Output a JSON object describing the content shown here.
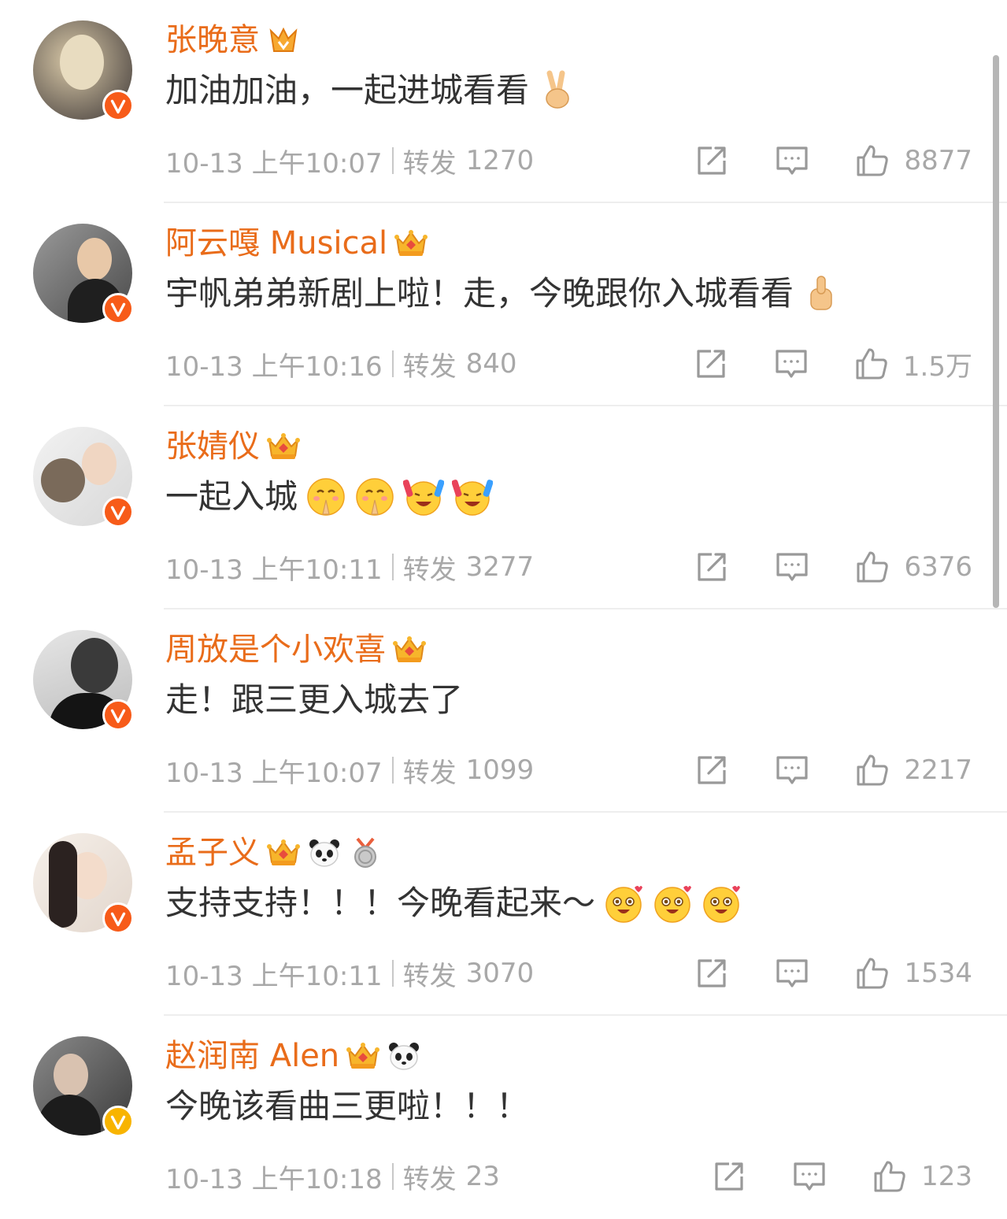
{
  "comments": [
    {
      "username": "张晚意",
      "text": "加油加油，一起进城看看",
      "time": "10-13 上午10:07",
      "repost_label": "转发",
      "repost_count": "1270",
      "likes": "8877",
      "verified_color": "#f75b19"
    },
    {
      "username": "阿云嘎 Musical",
      "text": "宇帆弟弟新剧上啦！走，今晚跟你入城看看",
      "time": "10-13 上午10:16",
      "repost_label": "转发",
      "repost_count": "840",
      "likes": "1.5万",
      "verified_color": "#f75b19"
    },
    {
      "username": "张婧仪",
      "text": "一起入城",
      "time": "10-13 上午10:11",
      "repost_label": "转发",
      "repost_count": "3277",
      "likes": "6376",
      "verified_color": "#f75b19"
    },
    {
      "username": "周放是个小欢喜",
      "text": "走！跟三更入城去了",
      "time": "10-13 上午10:07",
      "repost_label": "转发",
      "repost_count": "1099",
      "likes": "2217",
      "verified_color": "#f75b19"
    },
    {
      "username": "孟子义",
      "text": "支持支持！！！今晚看起来～",
      "time": "10-13 上午10:11",
      "repost_label": "转发",
      "repost_count": "3070",
      "likes": "1534",
      "verified_color": "#f75b19"
    },
    {
      "username": "赵润南 Alen",
      "text": "今晚该看曲三更啦！！！",
      "time": "10-13 上午10:18",
      "repost_label": "转发",
      "repost_count": "23",
      "likes": "123",
      "verified_color": "#f8b400"
    }
  ],
  "colors": {
    "username": "#e96c1a",
    "text": "#333333",
    "meta": "#a8a8a8",
    "divider": "#eeeeee"
  },
  "icons": {
    "share": "share-icon",
    "comment": "comment-icon",
    "like": "thumbs-up-icon",
    "verified": "verified-v-icon",
    "crown": "crown-badge-icon",
    "medal": "medal-badge-icon",
    "panda": "panda-icon"
  }
}
